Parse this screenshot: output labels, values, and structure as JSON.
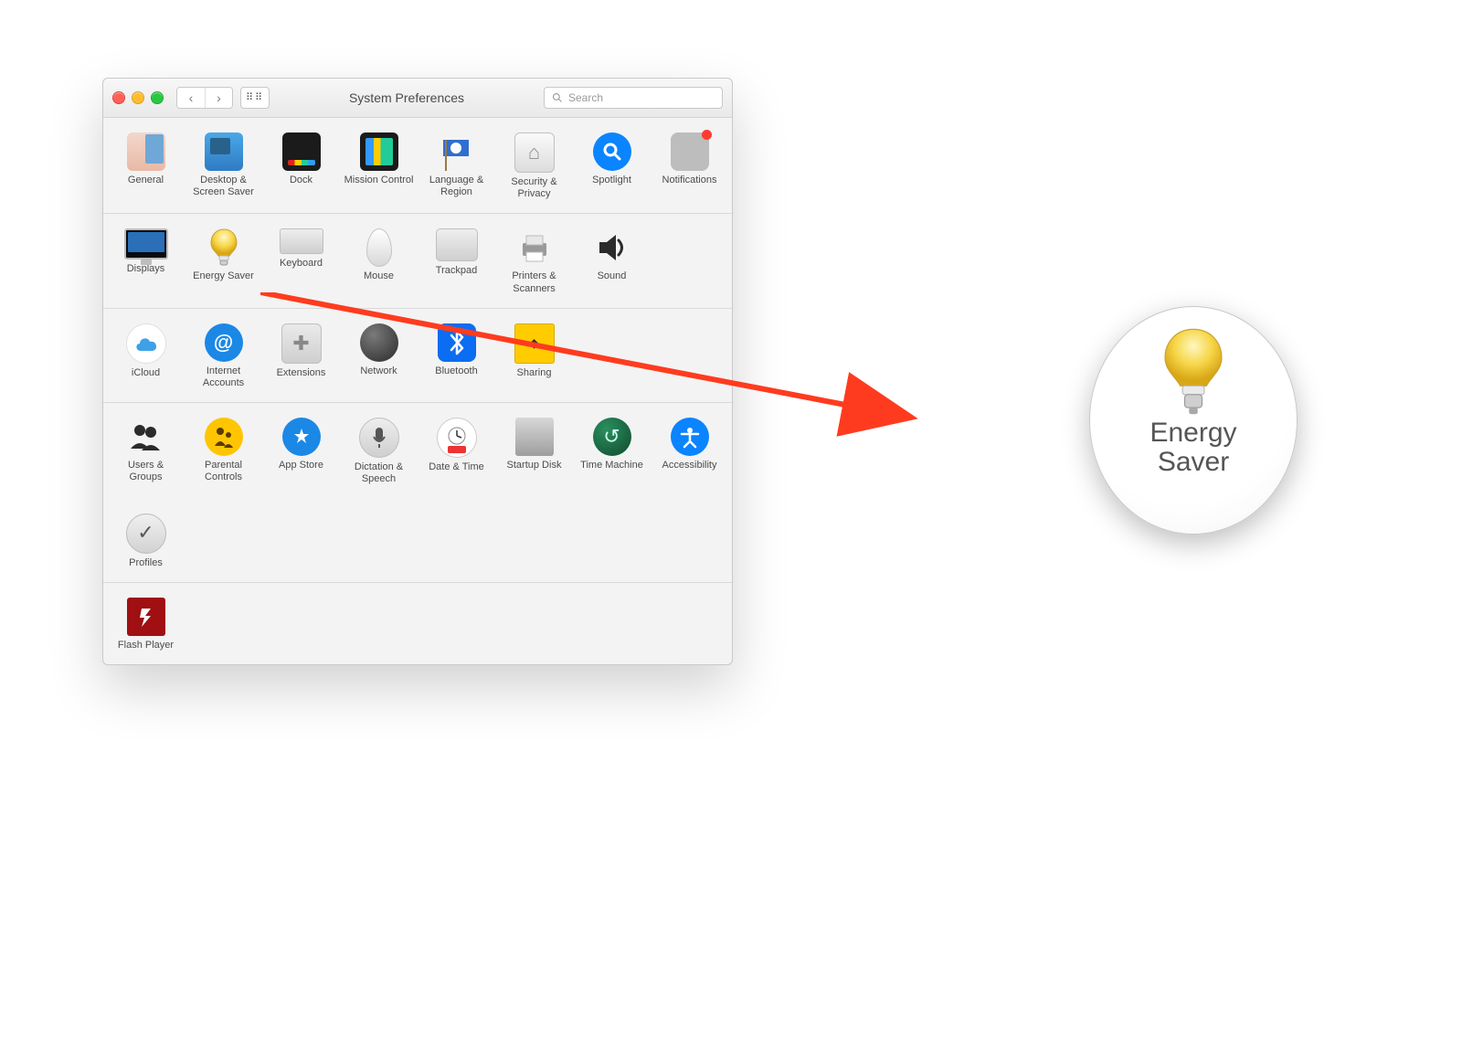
{
  "window": {
    "title": "System Preferences",
    "search_placeholder": "Search"
  },
  "rows": [
    [
      {
        "label": "General",
        "icon": "general"
      },
      {
        "label": "Desktop & Screen Saver",
        "icon": "desktop"
      },
      {
        "label": "Dock",
        "icon": "dock"
      },
      {
        "label": "Mission Control",
        "icon": "mission"
      },
      {
        "label": "Language & Region",
        "icon": "language"
      },
      {
        "label": "Security & Privacy",
        "icon": "security"
      },
      {
        "label": "Spotlight",
        "icon": "spotlight"
      },
      {
        "label": "Notifications",
        "icon": "notifications"
      }
    ],
    [
      {
        "label": "Displays",
        "icon": "displays"
      },
      {
        "label": "Energy Saver",
        "icon": "bulb"
      },
      {
        "label": "Keyboard",
        "icon": "keyboard"
      },
      {
        "label": "Mouse",
        "icon": "mouse"
      },
      {
        "label": "Trackpad",
        "icon": "trackpad"
      },
      {
        "label": "Printers & Scanners",
        "icon": "printer"
      },
      {
        "label": "Sound",
        "icon": "sound"
      }
    ],
    [
      {
        "label": "iCloud",
        "icon": "icloud"
      },
      {
        "label": "Internet Accounts",
        "icon": "internet"
      },
      {
        "label": "Extensions",
        "icon": "ext"
      },
      {
        "label": "Network",
        "icon": "network"
      },
      {
        "label": "Bluetooth",
        "icon": "bt"
      },
      {
        "label": "Sharing",
        "icon": "sharing"
      }
    ],
    [
      {
        "label": "Users & Groups",
        "icon": "users"
      },
      {
        "label": "Parental Controls",
        "icon": "parental"
      },
      {
        "label": "App Store",
        "icon": "appstore"
      },
      {
        "label": "Dictation & Speech",
        "icon": "dictation"
      },
      {
        "label": "Date & Time",
        "icon": "datetime"
      },
      {
        "label": "Startup Disk",
        "icon": "startup"
      },
      {
        "label": "Time Machine",
        "icon": "time"
      },
      {
        "label": "Accessibility",
        "icon": "accessibility"
      }
    ],
    [
      {
        "label": "Profiles",
        "icon": "profiles"
      }
    ],
    [
      {
        "label": "Flash Player",
        "icon": "flash"
      }
    ]
  ],
  "callout": {
    "line1": "Energy",
    "line2": "Saver"
  }
}
